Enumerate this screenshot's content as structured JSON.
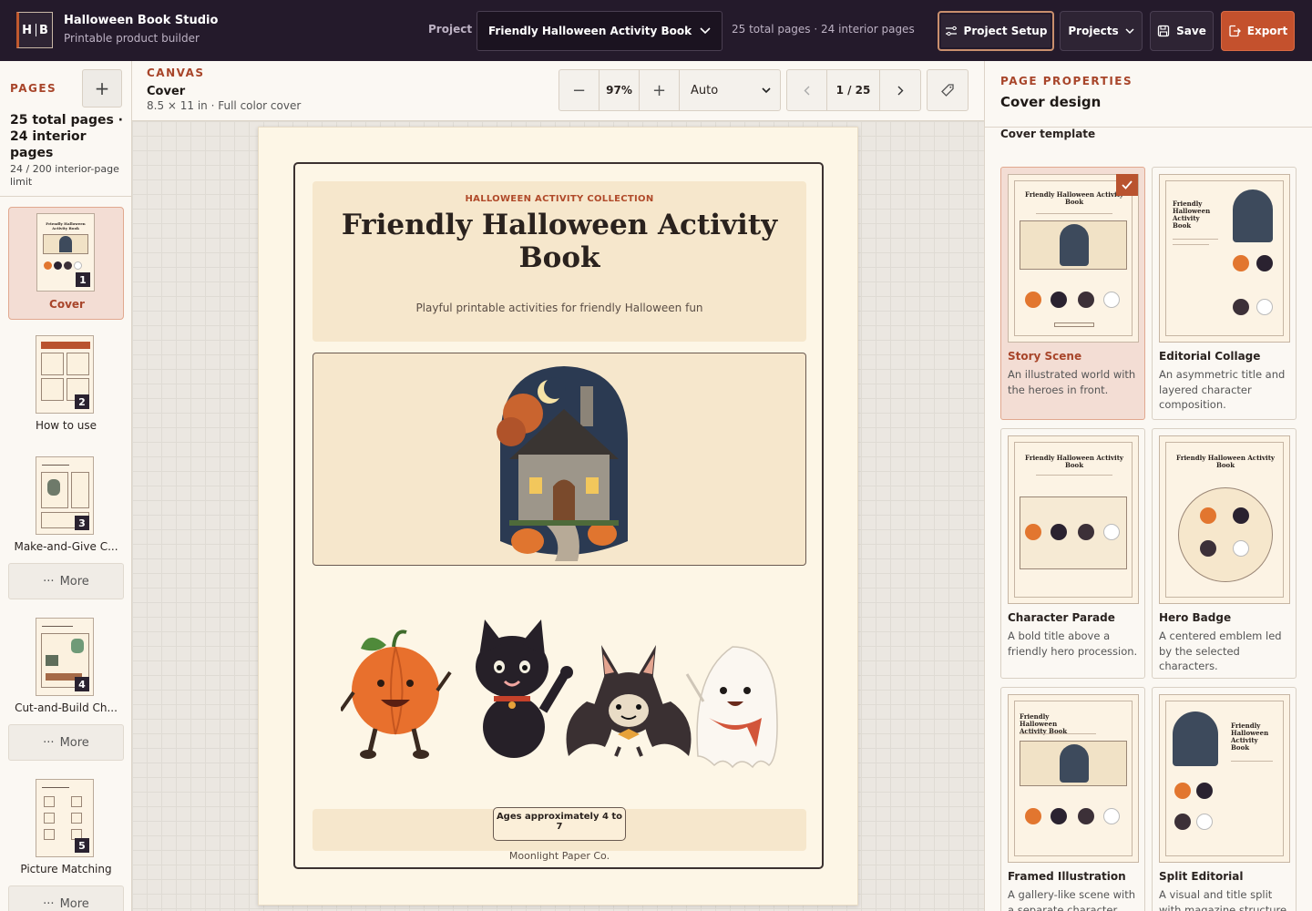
{
  "app": {
    "logo": "H|B",
    "logo_left": "H",
    "logo_right": "B",
    "title": "Halloween Book Studio",
    "subtitle": "Printable product builder"
  },
  "topbar": {
    "project_label": "Project",
    "project_value": "Friendly Halloween Activity Book",
    "project_meta": "25 total pages · 24 interior pages",
    "setup_label": "Project Setup",
    "projects_label": "Projects",
    "save_label": "Save",
    "export_label": "Export"
  },
  "sidebar": {
    "label": "PAGES",
    "count": "25 total pages · 24 interior pages",
    "limit": "24 / 200 interior-page limit",
    "more_label": "More",
    "pages": [
      {
        "num": "1",
        "label": "Cover"
      },
      {
        "num": "2",
        "label": "How to use"
      },
      {
        "num": "3",
        "label": "Make-and-Give C..."
      },
      {
        "num": "4",
        "label": "Cut-and-Build Ch..."
      },
      {
        "num": "5",
        "label": "Picture Matching"
      }
    ]
  },
  "canvas": {
    "label": "CANVAS",
    "page_name": "Cover",
    "page_meta": "8.5 × 11 in · Full color cover",
    "zoom": "97%",
    "fit": "Auto",
    "page_indicator": "1 / 25"
  },
  "cover": {
    "kicker": "HALLOWEEN ACTIVITY COLLECTION",
    "title": "Friendly Halloween Activity Book",
    "subtitle": "Playful printable activities for friendly Halloween fun",
    "ages": "Ages approximately 4 to 7",
    "publisher": "Moonlight Paper Co."
  },
  "panel": {
    "label": "PAGE PROPERTIES",
    "title": "Cover design",
    "subtitle": "Cover template",
    "templates": [
      {
        "name": "Story Scene",
        "desc": "An illustrated world with the heroes in front.",
        "selected": true
      },
      {
        "name": "Editorial Collage",
        "desc": "An asymmetric title and layered character composition."
      },
      {
        "name": "Character Parade",
        "desc": "A bold title above a friendly hero procession."
      },
      {
        "name": "Hero Badge",
        "desc": "A centered emblem led by the selected characters."
      },
      {
        "name": "Framed Illustration",
        "desc": "A gallery-like scene with a separate character row."
      },
      {
        "name": "Split Editorial",
        "desc": "A visual and title split with magazine structure."
      }
    ]
  },
  "colors": {
    "topbar": "#241a2b",
    "accent": "#a8452a",
    "export": "#c4512d",
    "paper": "#fdf6e6"
  }
}
